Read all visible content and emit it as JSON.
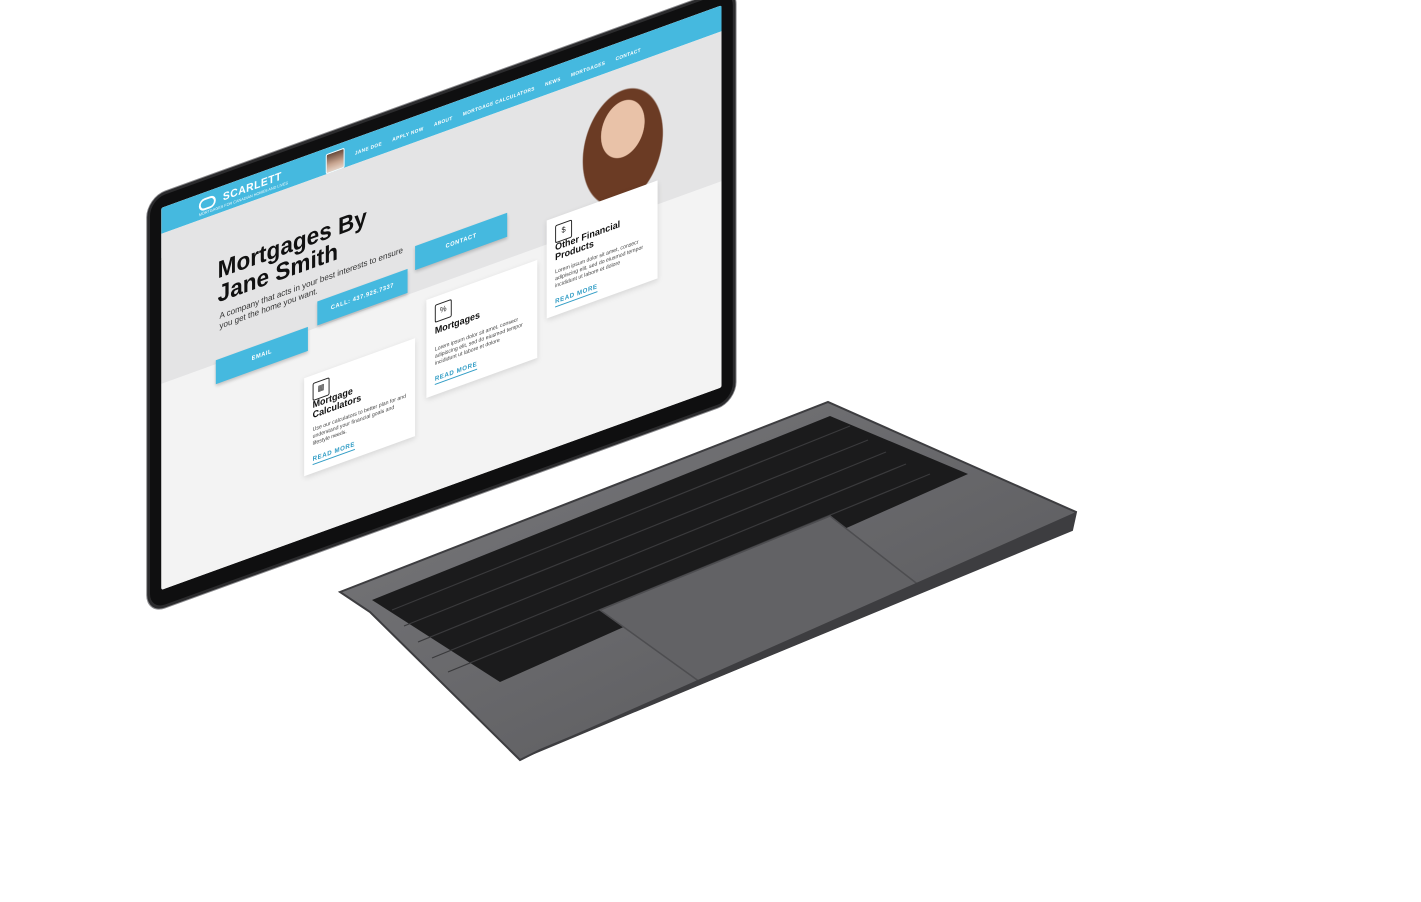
{
  "site": {
    "logo": {
      "brand": "SCARLETT",
      "powered_by": "POWERED BY",
      "tagline": "MORTGAGES FOR CANADIAN HOMES AND LIVES"
    },
    "nav": {
      "profile_name": "JANE DOE",
      "items": [
        "APPLY NOW",
        "ABOUT",
        "MORTGAGE CALCULATORS",
        "NEWS",
        "MORTGAGES",
        "CONTACT"
      ]
    },
    "hero": {
      "title": "Mortgages By Jane Smith",
      "subtitle": "A company that acts in your best interests to ensure you get the home you want.",
      "buttons": {
        "email": "EMAIL",
        "call": "CALL: 437.925.7337",
        "contact": "CONTACT"
      }
    },
    "cards": [
      {
        "icon": "calculator-house-icon",
        "title": "Mortgage Calculators",
        "text": "Use our calculators to better plan for and understand your financial goals and lifestyle needs.",
        "link": "READ MORE"
      },
      {
        "icon": "house-percent-icon",
        "title": "Mortgages",
        "text": "Lorem ipsum dolor sit amet, consecr adipiscing elit, sed do eiusmod tempor incididunt ut labore et dolore",
        "link": "READ MORE"
      },
      {
        "icon": "coins-stack-icon",
        "title": "Other Financial Products",
        "text": "Lorem ipsum dolor sit amet, consecr adipiscing elit, sed do eiusmod tempor incididunt ut labore et dolore",
        "link": "READ MORE"
      }
    ]
  },
  "colors": {
    "brand_blue": "#45b9df",
    "link_blue": "#2f9cc5",
    "laptop_body": "#6b6b6e",
    "keyboard": "#151515"
  }
}
